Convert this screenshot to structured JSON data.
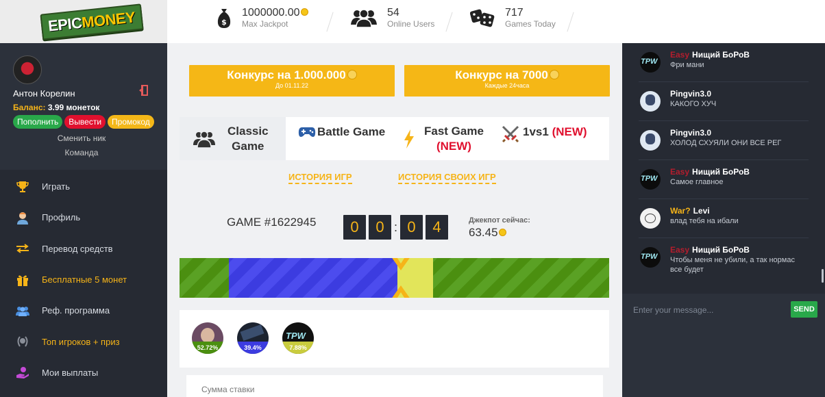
{
  "logo": {
    "word1": "EPIC",
    "word2": "MONEY"
  },
  "stats": [
    {
      "value": "1000000.00",
      "label": "Max Jackpot",
      "icon": "money-bag-icon"
    },
    {
      "value": "54",
      "label": "Online Users",
      "icon": "users-icon"
    },
    {
      "value": "717",
      "label": "Games Today",
      "icon": "dice-icon"
    }
  ],
  "profile": {
    "name": "Антон Корелин",
    "balance_label": "Баланс:",
    "balance_value": "3.99 монеток",
    "deposit": "Пополнить",
    "withdraw": "Вывести",
    "promo": "Промокод",
    "change_nick": "Сменить ник",
    "team": "Команда"
  },
  "nav": [
    {
      "label": "Играть",
      "icon": "trophy-icon",
      "highlight": false
    },
    {
      "label": "Профиль",
      "icon": "user-icon",
      "highlight": false
    },
    {
      "label": "Перевод средств",
      "icon": "transfer-icon",
      "highlight": false
    },
    {
      "label": "Бесплатные 5 монет",
      "icon": "gift-icon",
      "highlight": true
    },
    {
      "label": "Реф. программа",
      "icon": "referral-icon",
      "highlight": false
    },
    {
      "label": "Топ игроков + приз",
      "icon": "laurel-icon",
      "highlight": true
    },
    {
      "label": "Мои выплаты",
      "icon": "payout-icon",
      "highlight": false
    }
  ],
  "contests": [
    {
      "title": "Конкурс на 1.000.000",
      "sub": "До 01.11.22"
    },
    {
      "title": "Конкурс на 7000",
      "sub": "Каждые 24часа"
    }
  ],
  "modes": {
    "classic1": "Classic",
    "classic2": "Game",
    "battle": "Battle Game",
    "fast": "Fast Game",
    "new": "(NEW)",
    "onevone": "1vs1"
  },
  "history": {
    "all": "ИСТОРИЯ ИГР",
    "own": "ИСТОРИЯ СВОИХ ИГР"
  },
  "game": {
    "id": "GAME #1622945",
    "timer": [
      "0",
      "0",
      "0",
      "4"
    ],
    "jackpot_label": "Джекпот сейчас:",
    "jackpot_value": "63.45"
  },
  "players": [
    {
      "percent": "52.72%",
      "color": "#4b8f10"
    },
    {
      "percent": "39.4%",
      "color": "#3c3ce0"
    },
    {
      "percent": "7.88%",
      "color": "#e2e55a"
    }
  ],
  "bet": {
    "label": "Сумма ставки"
  },
  "chat": [
    {
      "rank": "Easy",
      "rank_color": "#b41d2d",
      "name": "Нищий БоРоВ",
      "text": "Фри мани",
      "avatar": "tpw"
    },
    {
      "rank": "",
      "rank_color": "",
      "name": "Pingvin3.0",
      "text": "КАКОГО ХУЧ",
      "avatar": "anime"
    },
    {
      "rank": "",
      "rank_color": "",
      "name": "Pingvin3.0",
      "text": "ХОЛОД СХУЯЛИ ОНИ ВСЕ РЕГ",
      "avatar": "anime"
    },
    {
      "rank": "Easy",
      "rank_color": "#b41d2d",
      "name": "Нищий БоРоВ",
      "text": "Самое главное",
      "avatar": "tpw"
    },
    {
      "rank": "War?",
      "rank_color": "#f6b418",
      "name": "Levi",
      "text": "влад тебя на ибали",
      "avatar": "sketch"
    },
    {
      "rank": "Easy",
      "rank_color": "#b41d2d",
      "name": "Нищий БоРоВ",
      "text": "Чтобы меня не убили, а так нормас все будет",
      "avatar": "tpw"
    }
  ],
  "chat_input": {
    "placeholder": "Enter your message...",
    "send": "SEND"
  },
  "colors": {
    "accent": "#f6b418",
    "sidebar": "#262a33",
    "green": "#29a84a",
    "red": "#e0102e"
  }
}
